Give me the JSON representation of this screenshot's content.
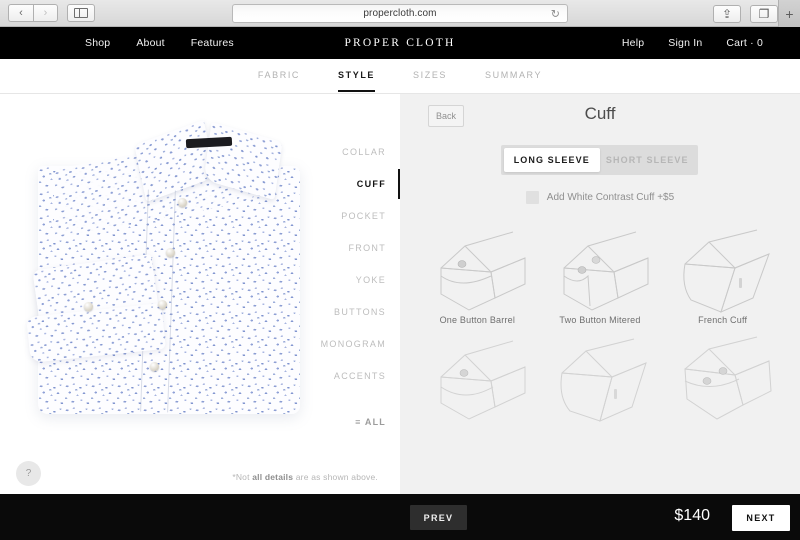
{
  "browser": {
    "url": "propercloth.com",
    "back_icon": "chevron-left-icon",
    "forward_icon": "chevron-right-icon",
    "sidebar_icon": "sidebar-toggle-icon",
    "reload_icon": "reload-icon",
    "share_icon": "share-icon",
    "tabs_icon": "tabs-icon",
    "new_tab_label": "+"
  },
  "site_nav": {
    "brand": "PROPER CLOTH",
    "left_links": [
      "Shop",
      "About",
      "Features"
    ],
    "right_links": [
      "Help",
      "Sign In",
      "Cart · 0"
    ]
  },
  "steps": [
    {
      "label": "FABRIC",
      "active": false
    },
    {
      "label": "STYLE",
      "active": true
    },
    {
      "label": "SIZES",
      "active": false
    },
    {
      "label": "SUMMARY",
      "active": false
    }
  ],
  "parts": [
    {
      "label": "COLLAR",
      "active": false
    },
    {
      "label": "CUFF",
      "active": true
    },
    {
      "label": "POCKET",
      "active": false
    },
    {
      "label": "FRONT",
      "active": false
    },
    {
      "label": "YOKE",
      "active": false
    },
    {
      "label": "BUTTONS",
      "active": false
    },
    {
      "label": "MONOGRAM",
      "active": false
    },
    {
      "label": "ACCENTS",
      "active": false
    }
  ],
  "parts_all_label": "≡ ALL",
  "preview": {
    "disclaimer_prefix": "*Not ",
    "disclaimer_bold": "all details",
    "disclaimer_suffix": " are as shown above.",
    "help_label": "?"
  },
  "config": {
    "back_label": "Back",
    "title": "Cuff",
    "sleeve_options": [
      {
        "label": "LONG SLEEVE",
        "active": true
      },
      {
        "label": "SHORT SLEEVE",
        "active": false
      }
    ],
    "contrast_label": "Add White Contrast Cuff +$5",
    "contrast_checked": false,
    "cuff_options": [
      {
        "label": "One Button Barrel",
        "art": "one-button-barrel"
      },
      {
        "label": "Two Button Mitered",
        "art": "two-button-mitered"
      },
      {
        "label": "French Cuff",
        "art": "french-cuff"
      },
      {
        "label": "",
        "art": "rounded-barrel"
      },
      {
        "label": "",
        "art": "plain-french"
      },
      {
        "label": "",
        "art": "two-button-rounded"
      }
    ]
  },
  "footer": {
    "prev_label": "PREV",
    "price": "$140",
    "next_label": "NEXT"
  },
  "colors": {
    "nav_bg": "#000000",
    "panel_bg": "#f1f1f1",
    "accent": "#111111",
    "muted_text": "#b2b2b2"
  }
}
